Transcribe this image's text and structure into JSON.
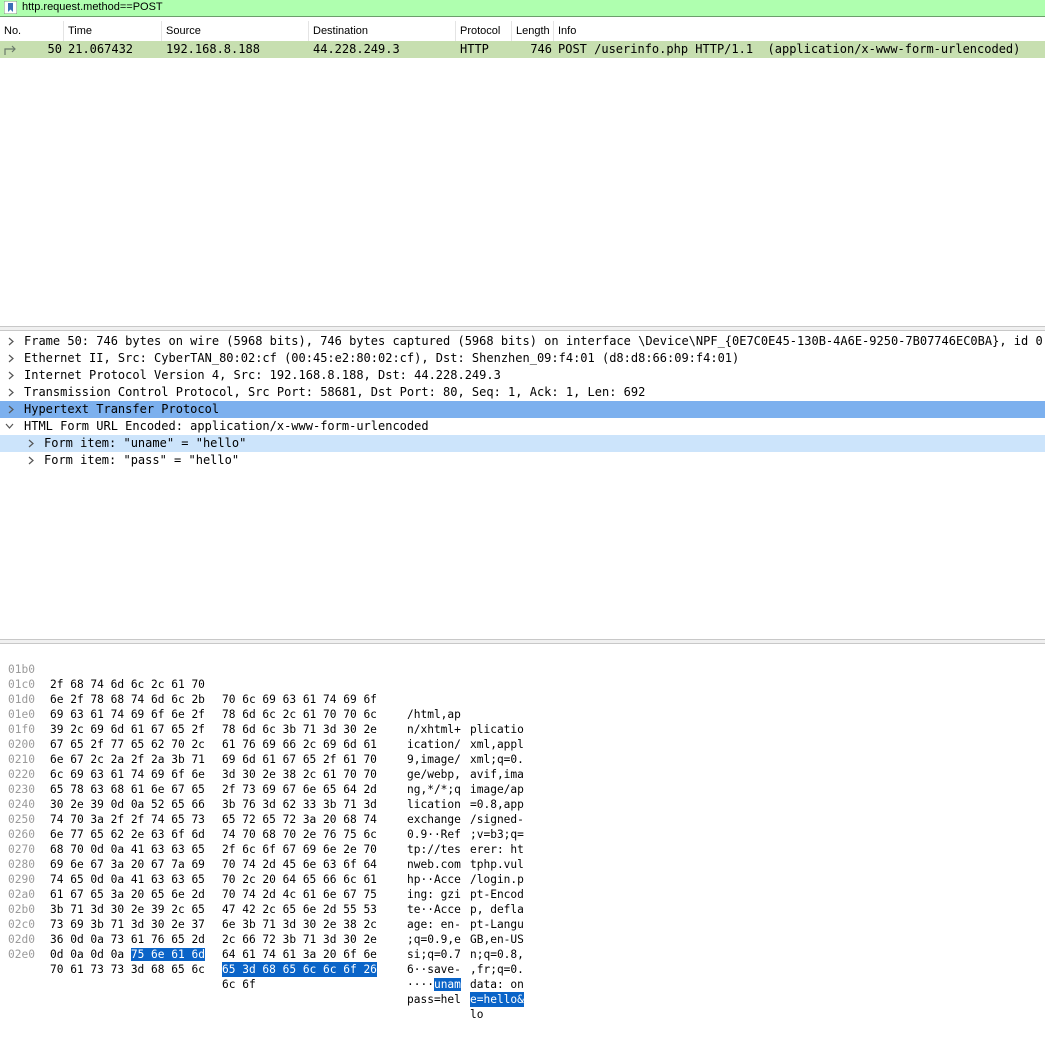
{
  "filter": {
    "value": "http.request.method==POST"
  },
  "packet_list": {
    "columns": [
      "No.",
      "Time",
      "Source",
      "Destination",
      "Protocol",
      "Length",
      "Info"
    ],
    "rows": [
      {
        "no": "50",
        "time": "21.067432",
        "source": "192.168.8.188",
        "destination": "44.228.249.3",
        "protocol": "HTTP",
        "length": "746",
        "info": "POST /userinfo.php HTTP/1.1  (application/x-www-form-urlencoded)"
      }
    ]
  },
  "details": [
    {
      "text": "Frame 50: 746 bytes on wire (5968 bits), 746 bytes captured (5968 bits) on interface \\Device\\NPF_{0E7C0E45-130B-4A6E-9250-7B07746EC0BA}, id 0",
      "expanded": false
    },
    {
      "text": "Ethernet II, Src: CyberTAN_80:02:cf (00:45:e2:80:02:cf), Dst: Shenzhen_09:f4:01 (d8:d8:66:09:f4:01)",
      "expanded": false
    },
    {
      "text": "Internet Protocol Version 4, Src: 192.168.8.188, Dst: 44.228.249.3",
      "expanded": false
    },
    {
      "text": "Transmission Control Protocol, Src Port: 58681, Dst Port: 80, Seq: 1, Ack: 1, Len: 692",
      "expanded": false
    },
    {
      "text": "Hypertext Transfer Protocol",
      "expanded": false
    },
    {
      "text": "HTML Form URL Encoded: application/x-www-form-urlencoded",
      "expanded": true
    },
    {
      "text": "Form item: \"uname\" = \"hello\"",
      "expanded": false
    },
    {
      "text": "Form item: \"pass\" = \"hello\"",
      "expanded": false
    }
  ],
  "bytes": [
    {
      "offset": "01b0",
      "hex_a": "2f 68 74 6d 6c 2c 61 70",
      "hex_b": "70 6c 69 63 61 74 69 6f",
      "ascii_a": "/html,ap",
      "ascii_b": "plicatio"
    },
    {
      "offset": "01c0",
      "hex_a": "6e 2f 78 68 74 6d 6c 2b",
      "hex_b": "78 6d 6c 2c 61 70 70 6c",
      "ascii_a": "n/xhtml+",
      "ascii_b": "xml,appl"
    },
    {
      "offset": "01d0",
      "hex_a": "69 63 61 74 69 6f 6e 2f",
      "hex_b": "78 6d 6c 3b 71 3d 30 2e",
      "ascii_a": "ication/",
      "ascii_b": "xml;q=0."
    },
    {
      "offset": "01e0",
      "hex_a": "39 2c 69 6d 61 67 65 2f",
      "hex_b": "61 76 69 66 2c 69 6d 61",
      "ascii_a": "9,image/",
      "ascii_b": "avif,ima"
    },
    {
      "offset": "01f0",
      "hex_a": "67 65 2f 77 65 62 70 2c",
      "hex_b": "69 6d 61 67 65 2f 61 70",
      "ascii_a": "ge/webp,",
      "ascii_b": "image/ap"
    },
    {
      "offset": "0200",
      "hex_a": "6e 67 2c 2a 2f 2a 3b 71",
      "hex_b": "3d 30 2e 38 2c 61 70 70",
      "ascii_a": "ng,*/*;q",
      "ascii_b": "=0.8,app"
    },
    {
      "offset": "0210",
      "hex_a": "6c 69 63 61 74 69 6f 6e",
      "hex_b": "2f 73 69 67 6e 65 64 2d",
      "ascii_a": "lication",
      "ascii_b": "/signed-"
    },
    {
      "offset": "0220",
      "hex_a": "65 78 63 68 61 6e 67 65",
      "hex_b": "3b 76 3d 62 33 3b 71 3d",
      "ascii_a": "exchange",
      "ascii_b": ";v=b3;q="
    },
    {
      "offset": "0230",
      "hex_a": "30 2e 39 0d 0a 52 65 66",
      "hex_b": "65 72 65 72 3a 20 68 74",
      "ascii_a": "0.9··Ref",
      "ascii_b": "erer: ht"
    },
    {
      "offset": "0240",
      "hex_a": "74 70 3a 2f 2f 74 65 73",
      "hex_b": "74 70 68 70 2e 76 75 6c",
      "ascii_a": "tp://tes",
      "ascii_b": "tphp.vul"
    },
    {
      "offset": "0250",
      "hex_a": "6e 77 65 62 2e 63 6f 6d",
      "hex_b": "2f 6c 6f 67 69 6e 2e 70",
      "ascii_a": "nweb.com",
      "ascii_b": "/login.p"
    },
    {
      "offset": "0260",
      "hex_a": "68 70 0d 0a 41 63 63 65",
      "hex_b": "70 74 2d 45 6e 63 6f 64",
      "ascii_a": "hp··Acce",
      "ascii_b": "pt-Encod"
    },
    {
      "offset": "0270",
      "hex_a": "69 6e 67 3a 20 67 7a 69",
      "hex_b": "70 2c 20 64 65 66 6c 61",
      "ascii_a": "ing: gzi",
      "ascii_b": "p, defla"
    },
    {
      "offset": "0280",
      "hex_a": "74 65 0d 0a 41 63 63 65",
      "hex_b": "70 74 2d 4c 61 6e 67 75",
      "ascii_a": "te··Acce",
      "ascii_b": "pt-Langu"
    },
    {
      "offset": "0290",
      "hex_a": "61 67 65 3a 20 65 6e 2d",
      "hex_b": "47 42 2c 65 6e 2d 55 53",
      "ascii_a": "age: en-",
      "ascii_b": "GB,en-US"
    },
    {
      "offset": "02a0",
      "hex_a": "3b 71 3d 30 2e 39 2c 65",
      "hex_b": "6e 3b 71 3d 30 2e 38 2c",
      "ascii_a": ";q=0.9,e",
      "ascii_b": "n;q=0.8,"
    },
    {
      "offset": "02b0",
      "hex_a": "73 69 3b 71 3d 30 2e 37",
      "hex_b": "2c 66 72 3b 71 3d 30 2e",
      "ascii_a": "si;q=0.7",
      "ascii_b": ",fr;q=0."
    },
    {
      "offset": "02c0",
      "hex_a": "36 0d 0a 73 61 76 65 2d",
      "hex_b": "64 61 74 61 3a 20 6f 6e",
      "ascii_a": "6··save-",
      "ascii_b": "data: on"
    },
    {
      "offset": "02d0",
      "hex_a_plain": "0d 0a 0d 0a",
      "hex_a_hl": "75 6e 61 6d",
      "hex_b_hl": "65 3d 68 65 6c 6c 6f 26",
      "ascii_a_plain": "····",
      "ascii_a_hl": "unam",
      "ascii_b_hl": "e=hello&"
    },
    {
      "offset": "02e0",
      "hex_a": "70 61 73 73 3d 68 65 6c",
      "hex_b": "6c 6f",
      "ascii_a": "pass=hel",
      "ascii_b": "lo"
    }
  ],
  "colors": {
    "filter_valid": "#afffaf",
    "row_selected": "#c7dfb0",
    "tree_selected": "#7cb0ee",
    "tree_related": "#cce4fb",
    "bytes_highlight": "#0a64c8"
  }
}
